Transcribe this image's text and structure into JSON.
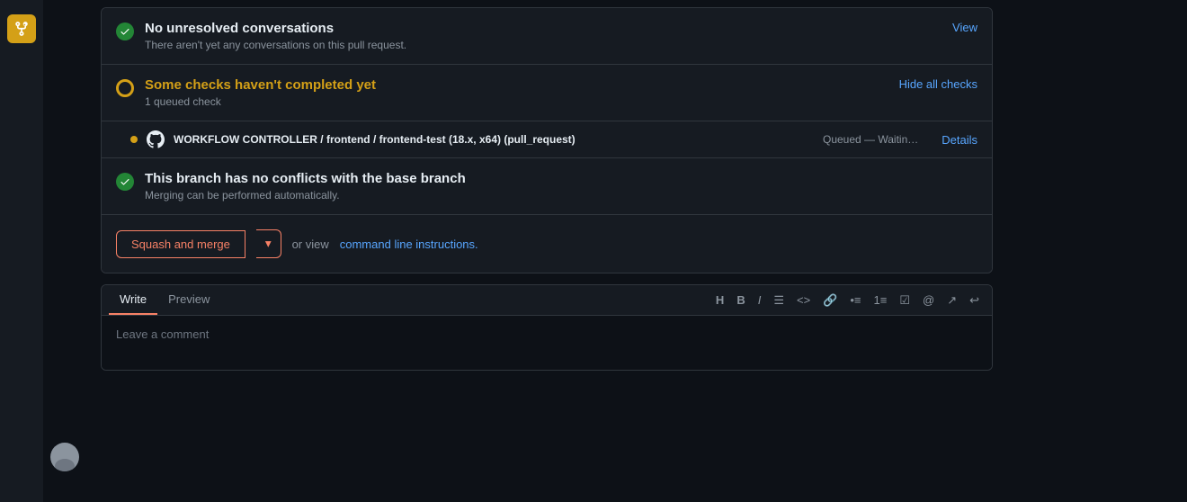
{
  "sidebar": {
    "git_icon": "git-merge-icon"
  },
  "checks": {
    "no_conversations": {
      "title": "No unresolved conversations",
      "subtitle": "There aren't yet any conversations on this pull request.",
      "link_label": "View"
    },
    "pending_checks": {
      "title": "Some checks haven't completed yet",
      "subtitle": "1 queued check",
      "link_label": "Hide all checks"
    },
    "workflow": {
      "name": "WORKFLOW CONTROLLER / frontend / frontend-test (18.x, x64) (pull_request)",
      "status": "Queued — Waitin…",
      "link_label": "Details"
    },
    "no_conflicts": {
      "title": "This branch has no conflicts with the base branch",
      "subtitle": "Merging can be performed automatically."
    }
  },
  "merge": {
    "squash_label": "Squash and merge",
    "dropdown_icon": "▾",
    "or_text": "or view",
    "cmd_link_label": "command line instructions.",
    "cmd_link_suffix": ""
  },
  "comment": {
    "write_tab": "Write",
    "preview_tab": "Preview",
    "placeholder": "Leave a comment",
    "toolbar_icons": [
      {
        "name": "heading-icon",
        "symbol": "H"
      },
      {
        "name": "bold-icon",
        "symbol": "B"
      },
      {
        "name": "italic-icon",
        "symbol": "I"
      },
      {
        "name": "list-unordered-icon",
        "symbol": "≡"
      },
      {
        "name": "code-icon",
        "symbol": "<>"
      },
      {
        "name": "link-icon",
        "symbol": "🔗"
      },
      {
        "name": "bullet-list-icon",
        "symbol": "•≡"
      },
      {
        "name": "numbered-list-icon",
        "symbol": "1≡"
      },
      {
        "name": "task-list-icon",
        "symbol": "☑≡"
      },
      {
        "name": "mention-icon",
        "symbol": "@"
      },
      {
        "name": "reference-icon",
        "symbol": "↗"
      },
      {
        "name": "undo-icon",
        "symbol": "↩"
      }
    ]
  }
}
